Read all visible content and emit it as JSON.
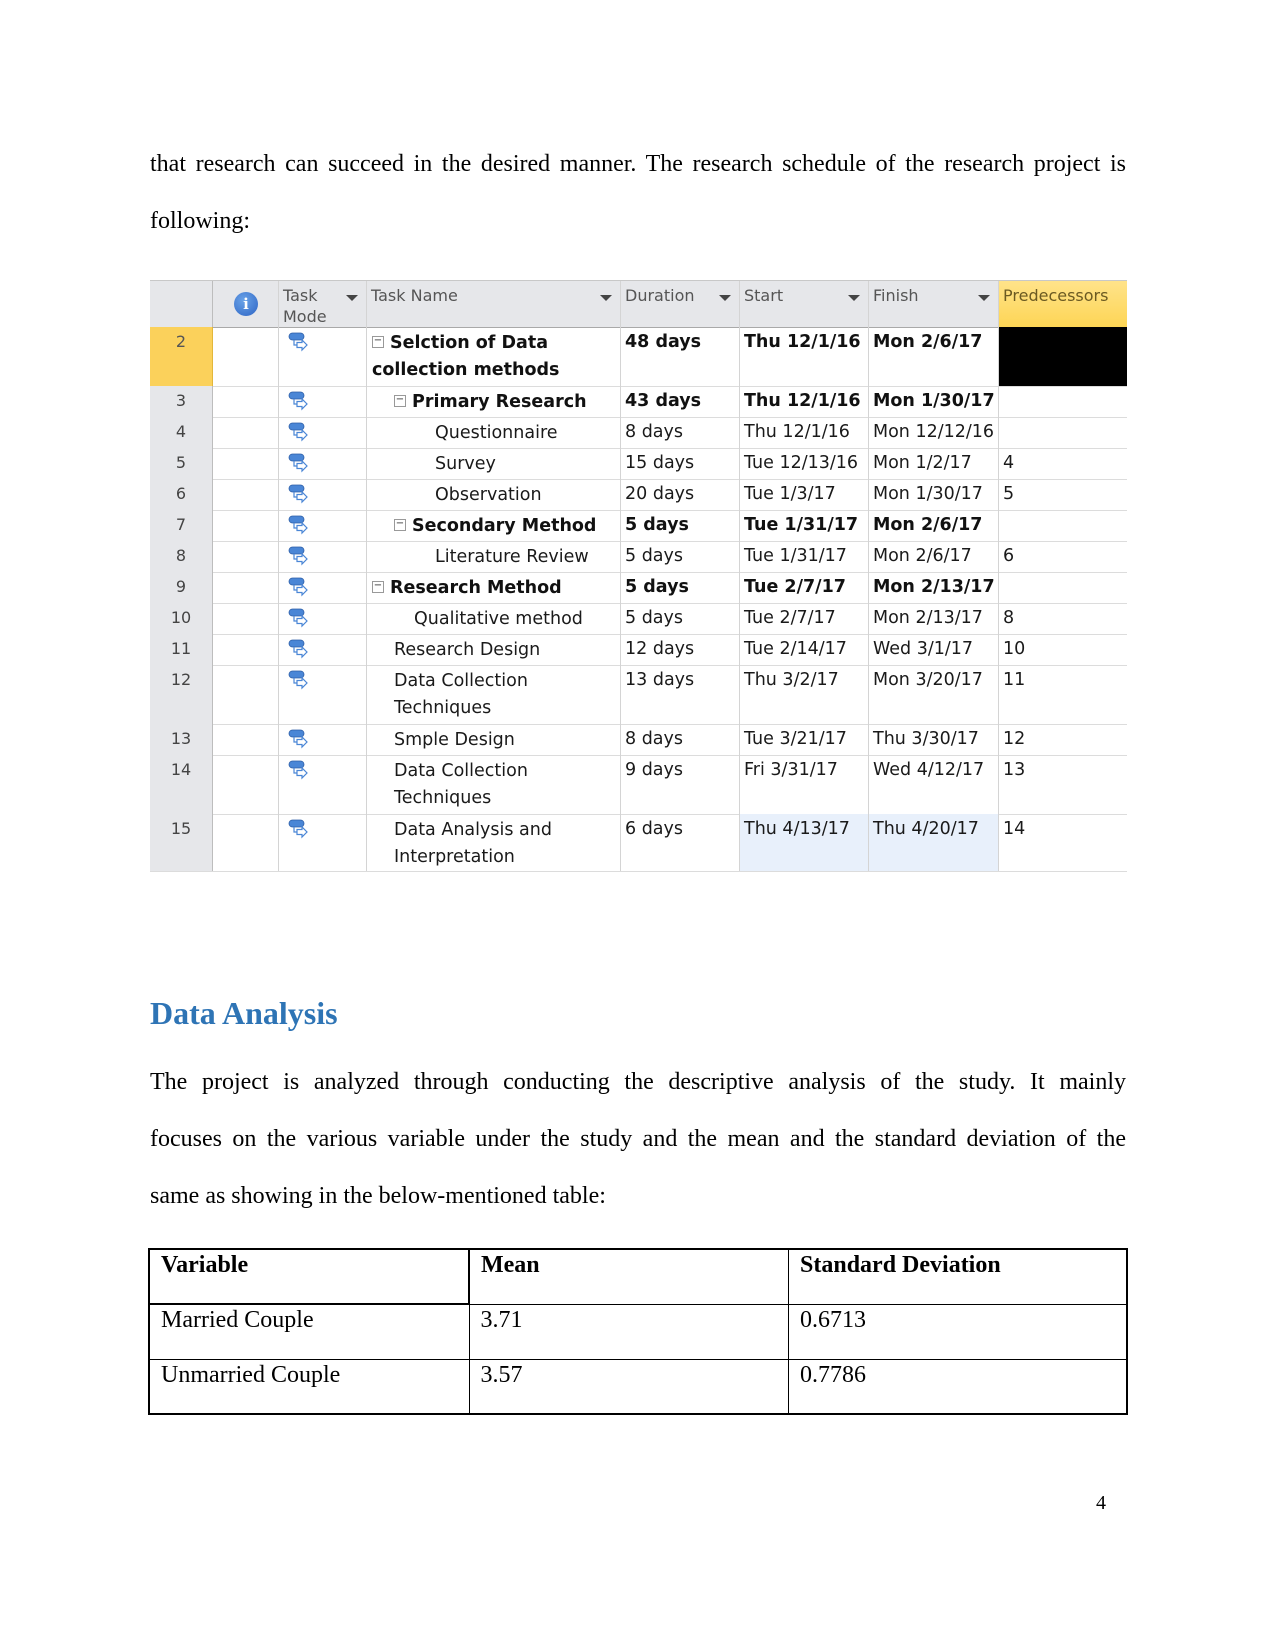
{
  "intro": {
    "text": "that research can succeed in the desired manner. The research schedule of the research project is following:"
  },
  "gantt": {
    "headers": {
      "info_icon": "info-icon",
      "task_mode": "Task Mode",
      "task_name": "Task Name",
      "duration": "Duration",
      "start": "Start",
      "finish": "Finish",
      "predecessors": "Predecessors"
    },
    "rows": [
      {
        "id": "2",
        "name": "Selction of Data collection methods",
        "duration": "48 days",
        "start": "Thu 12/1/16",
        "finish": "Mon 2/6/17",
        "predecessors": "",
        "summary": true,
        "level": 0,
        "selected": true
      },
      {
        "id": "3",
        "name": "Primary Research",
        "duration": "43 days",
        "start": "Thu 12/1/16",
        "finish": "Mon 1/30/17",
        "predecessors": "",
        "summary": true,
        "level": 1
      },
      {
        "id": "4",
        "name": "Questionnaire",
        "duration": "8 days",
        "start": "Thu 12/1/16",
        "finish": "Mon 12/12/16",
        "predecessors": "",
        "summary": false,
        "level": 2
      },
      {
        "id": "5",
        "name": "Survey",
        "duration": "15 days",
        "start": "Tue 12/13/16",
        "finish": "Mon 1/2/17",
        "predecessors": "4",
        "summary": false,
        "level": 2
      },
      {
        "id": "6",
        "name": "Observation",
        "duration": "20 days",
        "start": "Tue 1/3/17",
        "finish": "Mon 1/30/17",
        "predecessors": "5",
        "summary": false,
        "level": 2
      },
      {
        "id": "7",
        "name": "Secondary Method",
        "duration": "5 days",
        "start": "Tue 1/31/17",
        "finish": "Mon 2/6/17",
        "predecessors": "",
        "summary": true,
        "level": 1
      },
      {
        "id": "8",
        "name": "Literature Review",
        "duration": "5 days",
        "start": "Tue 1/31/17",
        "finish": "Mon 2/6/17",
        "predecessors": "6",
        "summary": false,
        "level": 2
      },
      {
        "id": "9",
        "name": "Research Method",
        "duration": "5 days",
        "start": "Tue 2/7/17",
        "finish": "Mon 2/13/17",
        "predecessors": "",
        "summary": true,
        "level": 0
      },
      {
        "id": "10",
        "name": "Qualitative method",
        "duration": "5 days",
        "start": "Tue 2/7/17",
        "finish": "Mon 2/13/17",
        "predecessors": "8",
        "summary": false,
        "level": 1
      },
      {
        "id": "11",
        "name": "Research Design",
        "duration": "12 days",
        "start": "Tue 2/14/17",
        "finish": "Wed 3/1/17",
        "predecessors": "10",
        "summary": false,
        "level": 0
      },
      {
        "id": "12",
        "name": "Data Collection Techniques",
        "duration": "13 days",
        "start": "Thu 3/2/17",
        "finish": "Mon 3/20/17",
        "predecessors": "11",
        "summary": false,
        "level": 0
      },
      {
        "id": "13",
        "name": "Smple Design",
        "duration": "8 days",
        "start": "Tue 3/21/17",
        "finish": "Thu 3/30/17",
        "predecessors": "12",
        "summary": false,
        "level": 0
      },
      {
        "id": "14",
        "name": "Data Collection Techniques",
        "duration": "9 days",
        "start": "Fri 3/31/17",
        "finish": "Wed 4/12/17",
        "predecessors": "13",
        "summary": false,
        "level": 0
      },
      {
        "id": "15",
        "name": "Data Analysis and Interpretation",
        "duration": "6 days",
        "start": "Thu 4/13/17",
        "finish": "Thu 4/20/17",
        "predecessors": "14",
        "summary": false,
        "level": 0
      }
    ],
    "colors": {
      "header_bg": "#e6e7ea",
      "selected_row": "#fbd15b",
      "predecessors_header": "#ffd966",
      "task_icon": "#4a86d6"
    }
  },
  "section": {
    "heading": "Data Analysis",
    "heading_color": "#2E74B5",
    "line1": "The project is analyzed through conducting the descriptive analysis of the study. It mainly",
    "line2": "focuses on the various variable under the study and the mean and the standard deviation of the",
    "line3": "same as showing in the below-mentioned table:"
  },
  "stats_table": {
    "headers": [
      "Variable",
      "Mean",
      "Standard Deviation"
    ],
    "rows": [
      [
        "Married Couple",
        "3.71",
        "0.6713"
      ],
      [
        "Unmarried Couple",
        "3.57",
        "0.7786"
      ]
    ]
  },
  "page_number": "4"
}
